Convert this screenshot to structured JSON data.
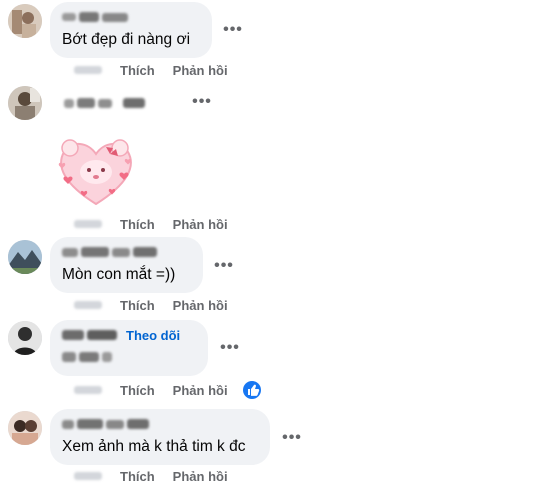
{
  "comments": [
    {
      "text": "Bớt đẹp đi nàng ơi",
      "like_label": "Thích",
      "reply_label": "Phản hồi",
      "menu_icon": "more-horizontal-icon",
      "avatar_color": "#b99a7c"
    },
    {
      "sticker": "pink-heart-bunny-sticker",
      "like_label": "Thích",
      "reply_label": "Phản hồi",
      "menu_icon": "more-horizontal-icon",
      "avatar_color": "#7b6f61"
    },
    {
      "text": "Mòn con mắt =))",
      "like_label": "Thích",
      "reply_label": "Phản hồi",
      "menu_icon": "more-horizontal-icon",
      "avatar_color": "#6d8aa3"
    },
    {
      "follow_label": "Theo dõi",
      "like_label": "Thích",
      "reply_label": "Phản hồi",
      "menu_icon": "more-horizontal-icon",
      "reaction_icon": "thumbs-up-icon",
      "avatar_color": "#3b3b3b"
    },
    {
      "text": "Xem ảnh mà k thả tim k đc",
      "like_label": "Thích",
      "reply_label": "Phản hồi",
      "menu_icon": "more-horizontal-icon",
      "avatar_color": "#c59b84"
    }
  ],
  "colors": {
    "bubble": "#f0f2f5",
    "secondary_text": "#65676b",
    "link_blue": "#0064d1",
    "like_blue": "#1877f2"
  }
}
